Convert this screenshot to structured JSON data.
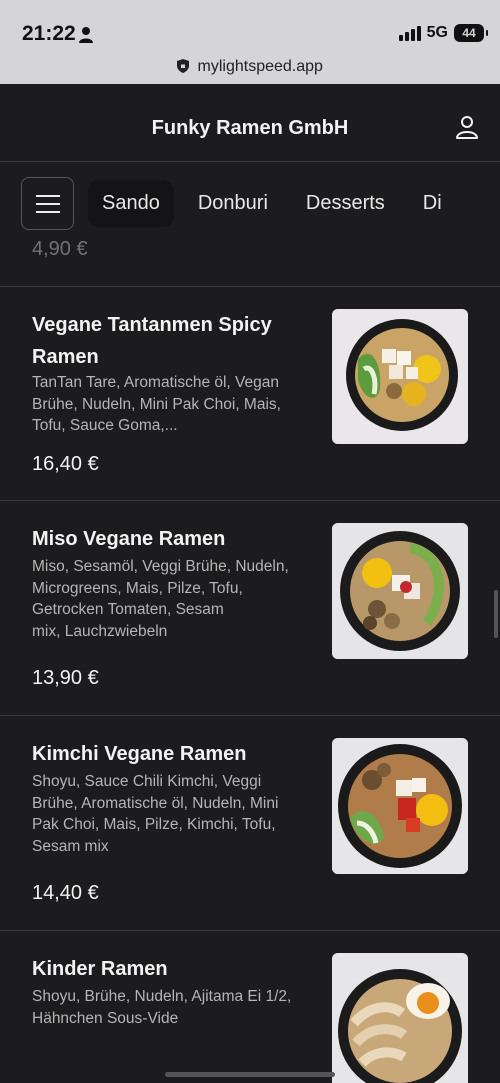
{
  "status": {
    "time": "21:22",
    "network": "5G",
    "battery": "44",
    "url": "mylightspeed.app"
  },
  "header": {
    "title": "Funky Ramen GmbH"
  },
  "categories": [
    "Sando",
    "Donburi",
    "Desserts",
    "Di"
  ],
  "partial_price": "4,90 €",
  "items": [
    {
      "name_line1": "Vegane Tantanmen Spicy",
      "name_line2": "Ramen",
      "desc": [
        "TanTan Tare, Aromatische öl, Vegan",
        "Brühe, Nudeln, Mini Pak Choi, Mais,",
        "Tofu, Sauce Goma,..."
      ],
      "price": "16,40 €"
    },
    {
      "name_line1": "Miso Vegane Ramen",
      "name_line2": "",
      "desc": [
        "Miso, Sesamöl, Veggi Brühe, Nudeln,",
        "Microgreens, Mais, Pilze, Tofu,",
        "Getrocken Tomaten, Sesam",
        "mix, Lauchzwiebeln"
      ],
      "price": "13,90 €"
    },
    {
      "name_line1": "Kimchi Vegane Ramen",
      "name_line2": "",
      "desc": [
        "Shoyu, Sauce Chili Kimchi, Veggi",
        "Brühe, Aromatische öl, Nudeln, Mini",
        "Pak Choi, Mais, Pilze, Kimchi, Tofu,",
        "Sesam mix"
      ],
      "price": "14,40 €"
    },
    {
      "name_line1": "Kinder Ramen",
      "name_line2": "",
      "desc": [
        "Shoyu, Brühe, Nudeln, Ajitama Ei 1/2,",
        "Hähnchen Sous-Vide"
      ],
      "price": ""
    }
  ],
  "icons": {
    "account": "person-outline-icon",
    "menu": "hamburger-menu-icon",
    "lock": "lock-shield-icon"
  }
}
